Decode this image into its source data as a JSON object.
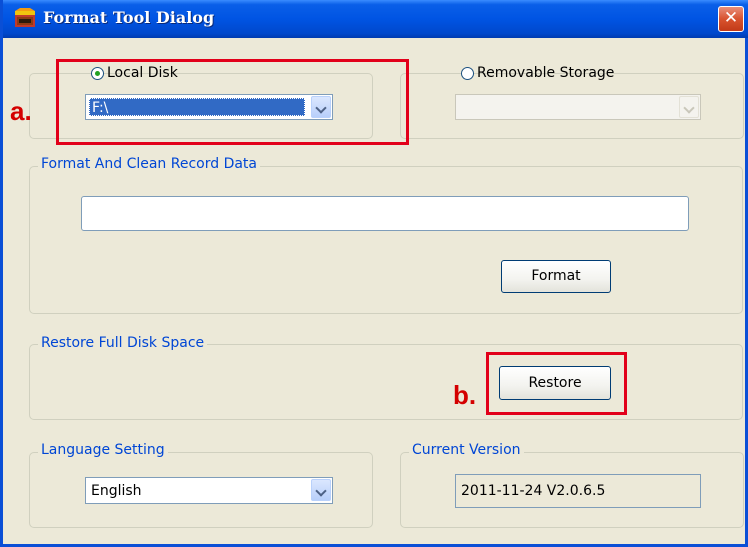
{
  "window": {
    "title": "Format Tool Dialog",
    "close_glyph": "✕"
  },
  "disk": {
    "local_label": "Local Disk",
    "local_selected": true,
    "local_value": "F:\\",
    "removable_label": "Removable Storage",
    "removable_selected": false,
    "removable_value": ""
  },
  "format_group": {
    "legend": "Format And Clean Record Data",
    "progress_text": "",
    "button_label": "Format"
  },
  "restore_group": {
    "legend": "Restore Full Disk Space",
    "button_label": "Restore"
  },
  "language_group": {
    "legend": "Language Setting",
    "value": "English"
  },
  "version_group": {
    "legend": "Current Version",
    "value": "2011-11-24 V2.0.6.5"
  },
  "annotations": {
    "a_label": "a.",
    "b_label": "b.",
    "color": "#e2001a"
  },
  "icons": {
    "title": "app-icon",
    "close": "close-icon",
    "dropdown": "chevron-down-icon"
  }
}
